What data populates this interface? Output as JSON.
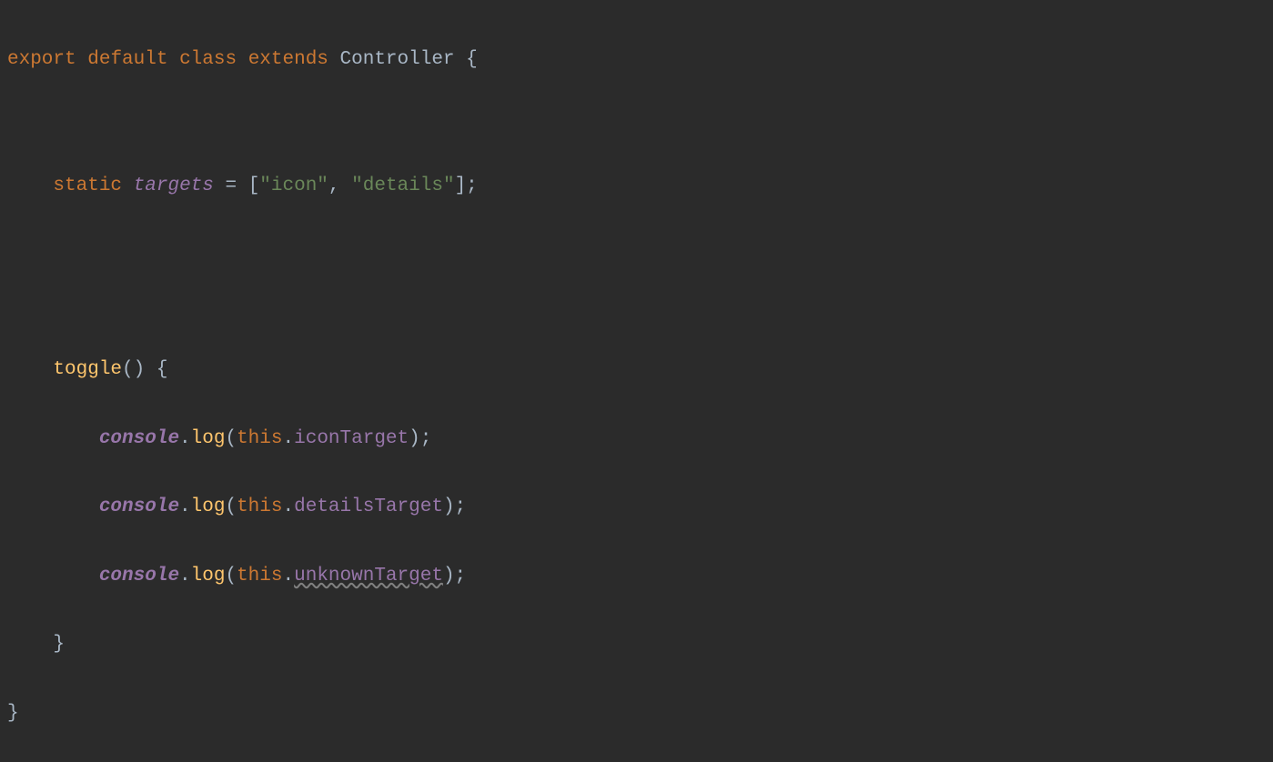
{
  "code": {
    "line1": {
      "export": "export",
      "default": "default",
      "class": "class",
      "extends": "extends",
      "controller": "Controller",
      "brace": " {"
    },
    "line2": {
      "indent": "    ",
      "static": "static",
      "targets": "targets",
      "equals": " = ",
      "lbracket": "[",
      "str1": "\"icon\"",
      "comma": ", ",
      "str2": "\"details\"",
      "rbracket": "]",
      "semi": ";"
    },
    "line3": {
      "indent": "    ",
      "toggle": "toggle",
      "parens": "()",
      "brace": " {"
    },
    "line4": {
      "indent": "        ",
      "console": "console",
      "dot": ".",
      "log": "log",
      "lparen": "(",
      "this": "this",
      "dot2": ".",
      "target": "iconTarget",
      "rparen": ")",
      "semi": ";"
    },
    "line5": {
      "indent": "        ",
      "console": "console",
      "dot": ".",
      "log": "log",
      "lparen": "(",
      "this": "this",
      "dot2": ".",
      "target": "detailsTarget",
      "rparen": ")",
      "semi": ";"
    },
    "line6": {
      "indent": "        ",
      "console": "console",
      "dot": ".",
      "log": "log",
      "lparen": "(",
      "this": "this",
      "dot2": ".",
      "target": "unknownTarget",
      "rparen": ")",
      "semi": ";"
    },
    "line7": {
      "indent": "    ",
      "brace": "}"
    },
    "line8": {
      "brace": "}"
    }
  }
}
